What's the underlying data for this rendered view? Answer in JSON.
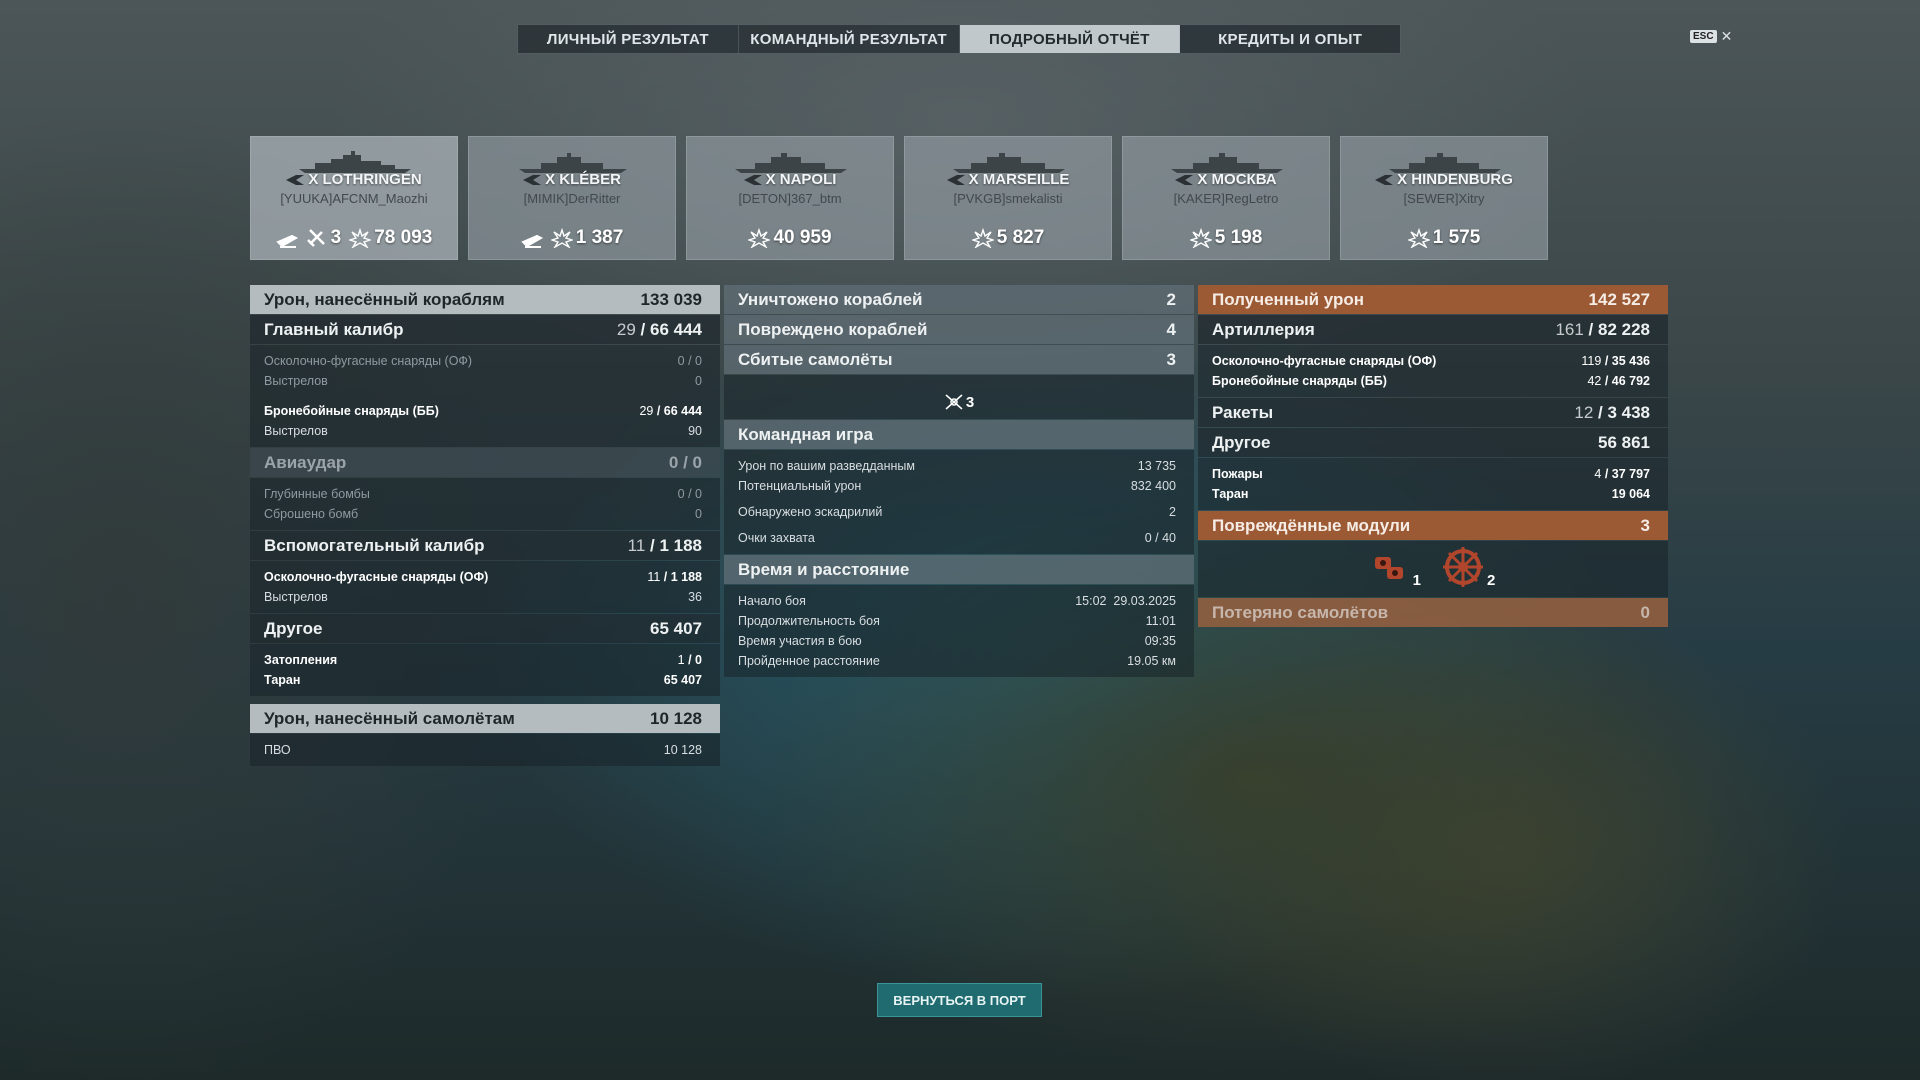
{
  "tabs": [
    "ЛИЧНЫЙ РЕЗУЛЬТАТ",
    "КОМАНДНЫЙ РЕЗУЛЬТАТ",
    "ПОДРОБНЫЙ ОТЧЁТ",
    "КРЕДИТЫ И ОПЫТ"
  ],
  "active_tab": "ПОДРОБНЫЙ ОТЧЁТ",
  "esc": {
    "key": "ESC",
    "close": "✕"
  },
  "ships": [
    {
      "name": "X LOTHRINGEN",
      "player": "[YUUKA]AFCNM_Maozhi",
      "ribbon_plane": "",
      "kills": "3",
      "damage": "78 093"
    },
    {
      "name": "X KLÉBER",
      "player": "[MIMIK]DerRitter",
      "ribbon_plane": "",
      "kills": "",
      "damage": "1 387"
    },
    {
      "name": "X NAPOLI",
      "player": "[DETON]367_btm",
      "ribbon_plane": "",
      "kills": "",
      "damage": "40 959"
    },
    {
      "name": "X MARSEILLE",
      "player": "[PVKGB]smekalisti",
      "ribbon_plane": "",
      "kills": "",
      "damage": "5 827"
    },
    {
      "name": "X МОСКВА",
      "player": "[KAKER]RegLetro",
      "ribbon_plane": "",
      "kills": "",
      "damage": "5 198"
    },
    {
      "name": "X HINDENBURG",
      "player": "[SEWER]Xitry",
      "ribbon_plane": "",
      "kills": "",
      "damage": "1 575"
    }
  ],
  "col1": {
    "damage_ships": {
      "label": "Урон, нанесённый кораблям",
      "value": "133 039"
    },
    "main_battery": {
      "label": "Главный калибр",
      "hits": "29",
      "dmg": "66 444"
    },
    "mb_he": {
      "label": "Осколочно-фугасные снаряды (ОФ)",
      "hits": "0",
      "dmg": "0"
    },
    "mb_he_shots": {
      "label": "Выстрелов",
      "value": "0"
    },
    "mb_ap": {
      "label": "Бронебойные снаряды (ББ)",
      "hits": "29",
      "dmg": "66 444"
    },
    "mb_ap_shots": {
      "label": "Выстрелов",
      "value": "90"
    },
    "airstrike": {
      "label": "Авиаудар",
      "hits": "0",
      "dmg": "0"
    },
    "depth_charges": {
      "label": "Глубинные бомбы",
      "hits": "0",
      "dmg": "0"
    },
    "bombs_dropped": {
      "label": "Сброшено бомб",
      "value": "0"
    },
    "secondary": {
      "label": "Вспомогательный калибр",
      "hits": "11",
      "dmg": "1 188"
    },
    "sec_he": {
      "label": "Осколочно-фугасные снаряды (ОФ)",
      "hits": "11",
      "dmg": "1 188"
    },
    "sec_shots": {
      "label": "Выстрелов",
      "value": "36"
    },
    "other": {
      "label": "Другое",
      "value": "65 407"
    },
    "flooding": {
      "label": "Затопления",
      "hits": "1",
      "dmg": "0"
    },
    "ram": {
      "label": "Таран",
      "value": "65 407"
    },
    "damage_planes": {
      "label": "Урон, нанесённый самолётам",
      "value": "10 128"
    },
    "aa": {
      "label": "ПВО",
      "value": "10 128"
    }
  },
  "col2": {
    "destroyed": {
      "label": "Уничтожено кораблей",
      "value": "2"
    },
    "damaged": {
      "label": "Повреждено кораблей",
      "value": "4"
    },
    "planes_shot": {
      "label": "Сбитые самолёты",
      "value": "3"
    },
    "planes_icon_count": "3",
    "team_play": {
      "label": "Командная игра"
    },
    "spotting_damage": {
      "label": "Урон по вашим разведданным",
      "value": "13 735"
    },
    "potential_damage": {
      "label": "Потенциальный урон",
      "value": "832 400"
    },
    "squadrons_spotted": {
      "label": "Обнаружено эскадрилий",
      "value": "2"
    },
    "capture_points": {
      "label": "Очки захвата",
      "a": "0",
      "b": "40"
    },
    "time_distance": {
      "label": "Время и расстояние"
    },
    "battle_start": {
      "label": "Начало боя",
      "value": "15:02  29.03.2025"
    },
    "battle_duration": {
      "label": "Продолжительность боя",
      "value": "11:01"
    },
    "time_in_battle": {
      "label": "Время участия в бою",
      "value": "09:35"
    },
    "distance": {
      "label": "Пройденное расстояние",
      "value": "19.05 км"
    }
  },
  "col3": {
    "received": {
      "label": "Полученный урон",
      "value": "142 527"
    },
    "artillery": {
      "label": "Артиллерия",
      "hits": "161",
      "dmg": "82 228"
    },
    "art_he": {
      "label": "Осколочно-фугасные снаряды (ОФ)",
      "hits": "119",
      "dmg": "35 436"
    },
    "art_ap": {
      "label": "Бронебойные снаряды (ББ)",
      "hits": "42",
      "dmg": "46 792"
    },
    "rockets": {
      "label": "Ракеты",
      "hits": "12",
      "dmg": "3 438"
    },
    "other": {
      "label": "Другое",
      "value": "56 861"
    },
    "fires": {
      "label": "Пожары",
      "hits": "4",
      "dmg": "37 797"
    },
    "ram": {
      "label": "Таран",
      "value": "19 064"
    },
    "modules": {
      "label": "Повреждённые модули",
      "value": "3"
    },
    "module_icons": [
      {
        "name": "engine",
        "count": "1"
      },
      {
        "name": "steering",
        "count": "2"
      }
    ],
    "planes_lost": {
      "label": "Потеряно самолётов",
      "value": "0"
    }
  },
  "back_button": "ВЕРНУТЬСЯ В ПОРТ"
}
